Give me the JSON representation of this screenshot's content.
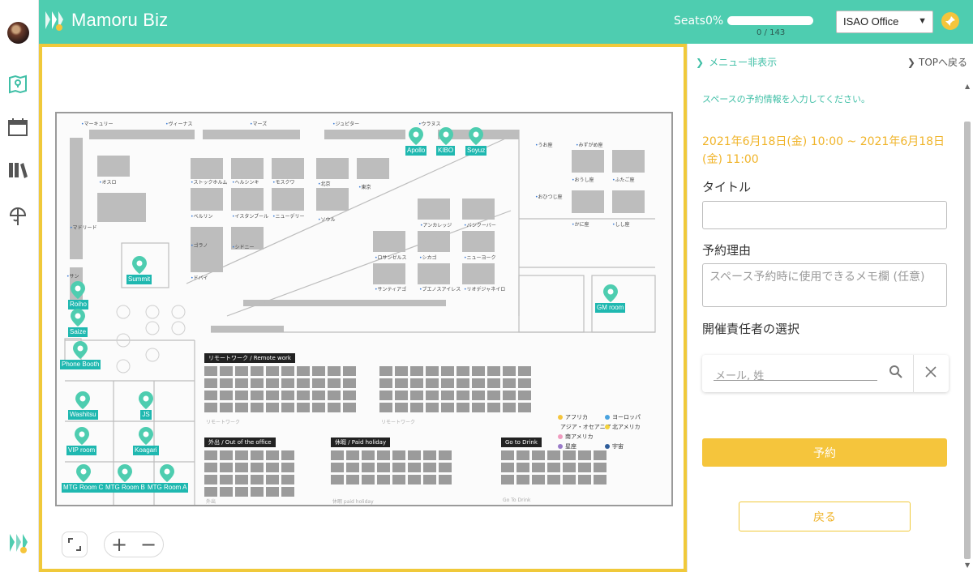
{
  "app": {
    "name": "Mamoru Biz"
  },
  "header": {
    "seats_label": "Seats",
    "seats_percent": "0%",
    "seats_fill": 0,
    "seats_count": "0 / 143",
    "office_selected": "ISAO Office"
  },
  "floor": {
    "top_labels": [
      "マーキュリー",
      "ヴィーナス",
      "マーズ",
      "ジュピター",
      "ウラヌス"
    ],
    "room_labels": {
      "oslo": "オスロ",
      "stockholm": "ストックホルム",
      "helsinki": "ヘルシンキ",
      "moscow": "モスクワ",
      "beijing": "北京",
      "tokyo": "東京",
      "berlin": "ベルリン",
      "istanbul": "イスタンブール",
      "newdelhi": "ニューデリー",
      "seoul": "ソウル",
      "madrid": "マドリード",
      "rome": "ローマ",
      "gerano": "ゴラノ",
      "sydney": "シドニー",
      "dubai": "ドバイ",
      "anchorage": "アンカレッジ",
      "vancouver": "バンクーバー",
      "losangeles": "ロサンゼルス",
      "chicago": "シカゴ",
      "newyork": "ニューヨーク",
      "santiago": "サンティアゴ",
      "buenosaires": "ブエノスアイレス",
      "riodejaneiro": "リオデジャネイロ",
      "uodza": "うお座",
      "mizugameza": "みずがめ座",
      "oushiza": "おうし座",
      "futagoza": "ふたご座",
      "ohitsujiza": "おひつじ座",
      "kaniza": "かに座",
      "shishiza": "しし座",
      "san": "サン"
    },
    "pins": {
      "apollo": "Apollo",
      "kibo": "KIBO",
      "soyuz": "Soyuz",
      "summit": "Summit",
      "roiho": "Roiho",
      "saize": "Saize",
      "phonebooth": "Phone Booth",
      "gmroom": "GM room",
      "washitsu": "Washitsu",
      "js": "JS",
      "viproom": "VIP room",
      "koagari": "Koagari",
      "mtgc": "MTG Room C",
      "mtgb": "MTG Room B",
      "mtga": "MTG Room A"
    },
    "zones": {
      "remote": {
        "title": "リモートワーク / Remote work",
        "foot": "リモートワーク"
      },
      "out": {
        "title": "外出 / Out of the office",
        "foot": "外出"
      },
      "holiday": {
        "title": "休暇 / Paid holiday",
        "foot": "休暇 paid holiday"
      },
      "drink": {
        "title": "Go to Drink",
        "foot": "Go To Drink"
      }
    },
    "legend": [
      {
        "label": "アフリカ",
        "color": "#f5c53c"
      },
      {
        "label": "ヨーロッパ",
        "color": "#4aa3df"
      },
      {
        "label": "アジア・オセアニア",
        "color": "#e2553c"
      },
      {
        "label": "北アメリカ",
        "color": "#f5d33c"
      },
      {
        "label": "南アメリカ",
        "color": "#f09cc0"
      },
      {
        "label": "星座",
        "color": "#9a7bc9"
      },
      {
        "label": "宇宙",
        "color": "#2f5d9a"
      }
    ]
  },
  "panel": {
    "menu_toggle": "メニュー非表示",
    "back_to_top": "TOPへ戻る",
    "instruction": "スペースの予約情報を入力してください。",
    "date_range": "2021年6月18日(金) 10:00 ~ 2021年6月18日(金) 11:00",
    "title_label": "タイトル",
    "title_value": "",
    "reason_label": "予約理由",
    "reason_placeholder": "スペース予約時に使用できるメモ欄 (任意)",
    "organizer_label": "開催責任者の選択",
    "organizer_placeholder": "メール, 姓",
    "reserve_button": "予約",
    "back_button": "戻る"
  },
  "colors": {
    "accent": "#4ecdb0",
    "highlight": "#f5c53c",
    "pin": "#1fb8b0"
  }
}
